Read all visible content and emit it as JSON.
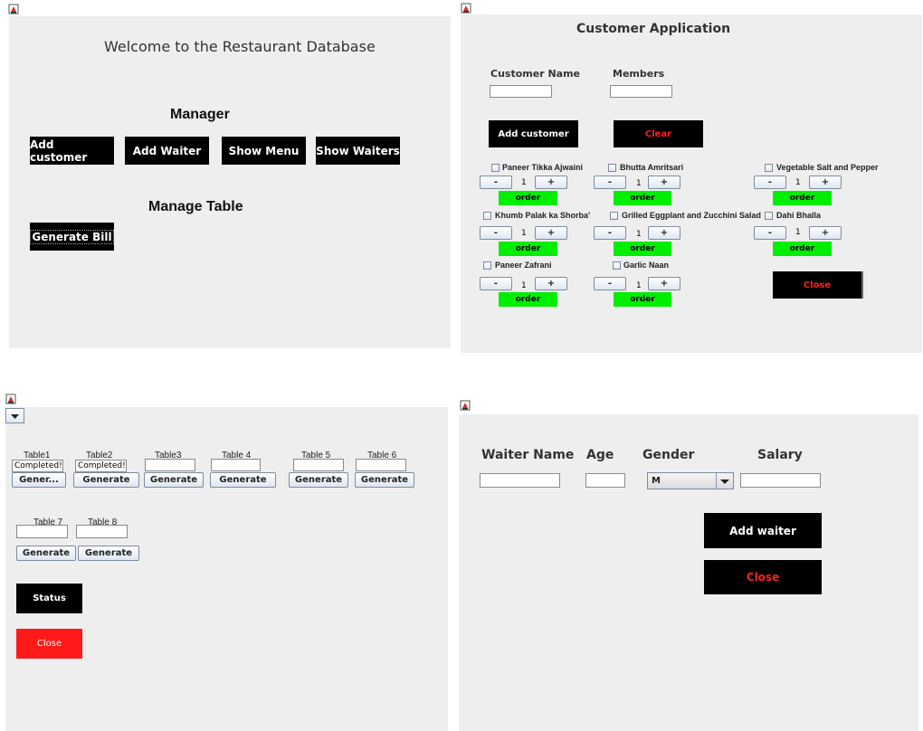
{
  "welcome": {
    "title": "Welcome to the Restaurant Database",
    "manager_heading": "Manager",
    "buttons": [
      "Add customer",
      "Add Waiter",
      "Show Menu",
      "Show Waiters"
    ],
    "manage_table_heading": "Manage Table",
    "generate_bill_label": "Generate Bill"
  },
  "customer": {
    "title": "Customer Application",
    "name_label": "Customer Name",
    "members_label": "Members",
    "name_value": "",
    "members_value": "",
    "add_label": "Add customer",
    "clear_label": "Clear",
    "close_label": "Close",
    "minus": "-",
    "plus": "+",
    "order_label": "order",
    "items": [
      {
        "name": "Paneer Tikka Ajwaini",
        "qty": "1"
      },
      {
        "name": "Bhutta Amritsari",
        "qty": "1"
      },
      {
        "name": "Vegetable Salt and Pepper",
        "qty": "1"
      },
      {
        "name": "Khumb Palak ka Shorba'",
        "qty": "1"
      },
      {
        "name": "Grilled Eggplant and Zucchini Salad",
        "qty": "1"
      },
      {
        "name": "Dahi Bhalla",
        "qty": "1"
      },
      {
        "name": "Paneer Zafrani",
        "qty": "1"
      },
      {
        "name": "Garlic Naan",
        "qty": "1"
      }
    ]
  },
  "tables": {
    "items": [
      {
        "label": "Table1",
        "status": "Completed!",
        "button": "Gener..."
      },
      {
        "label": "Table2",
        "status": "Completed!",
        "button": "Generate"
      },
      {
        "label": "Table3",
        "status": "",
        "button": "Generate"
      },
      {
        "label": "Table 4",
        "status": "",
        "button": "Generate"
      },
      {
        "label": "Table 5",
        "status": "",
        "button": "Generate"
      },
      {
        "label": "Table 6",
        "status": "",
        "button": "Generate"
      },
      {
        "label": "Table 7",
        "status": "",
        "button": "Generate"
      },
      {
        "label": "Table 8",
        "status": "",
        "button": "Generate"
      }
    ],
    "status_label": "Status",
    "close_label": "Close"
  },
  "waiter": {
    "name_label": "Waiter Name",
    "age_label": "Age",
    "gender_label": "Gender",
    "salary_label": "Salary",
    "name_value": "",
    "age_value": "",
    "gender_value": "M",
    "salary_value": "",
    "add_label": "Add waiter",
    "close_label": "Close"
  },
  "icons": [
    "java-window-icon",
    "dropdown-arrow-icon"
  ],
  "colors": {
    "panel_bg": "#eeeeee",
    "button_black": "#000000",
    "order_green": "#00ee00",
    "close_red": "#ff1a1a"
  }
}
